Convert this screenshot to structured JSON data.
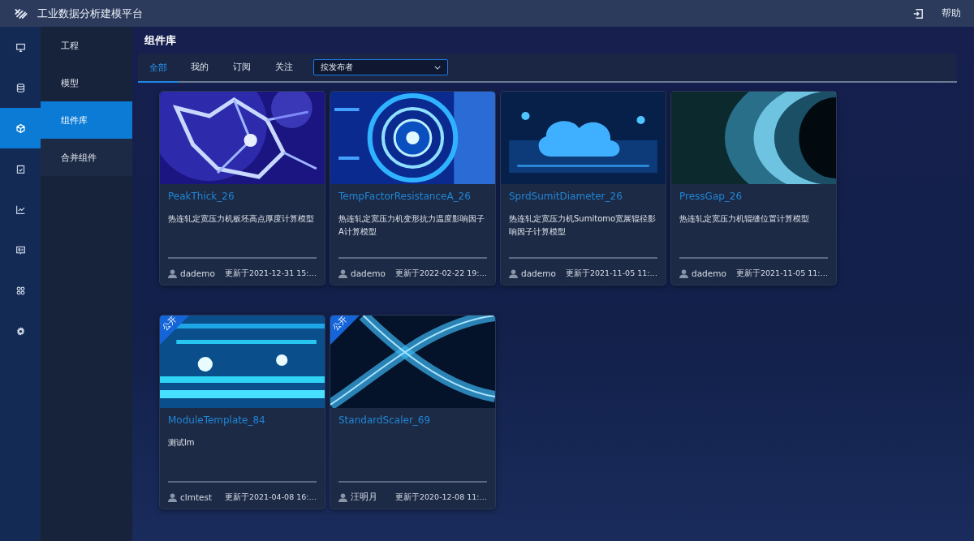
{
  "header": {
    "title": "工业数据分析建模平台",
    "help": "帮助"
  },
  "rail": [
    {
      "selected": false
    },
    {
      "selected": false
    },
    {
      "selected": true
    },
    {
      "selected": false
    },
    {
      "selected": false
    },
    {
      "selected": false
    },
    {
      "selected": false
    },
    {
      "selected": false
    }
  ],
  "submenu": [
    {
      "label": "工程",
      "selected": false
    },
    {
      "label": "模型",
      "selected": false
    },
    {
      "label": "组件库",
      "selected": true
    },
    {
      "label": "合并组件",
      "selected": false
    }
  ],
  "page_title": "组件库",
  "tabs": [
    {
      "label": "全部",
      "selected": true
    },
    {
      "label": "我的",
      "selected": false
    },
    {
      "label": "订阅",
      "selected": false
    },
    {
      "label": "关注",
      "selected": false
    }
  ],
  "filter": {
    "value": "按发布者"
  },
  "cards": [
    {
      "title": "PeakThick_26",
      "description": "热连轧定宽压力机板坯高点厚度计算模型",
      "author": "dademo",
      "updated": "更新于2021-12-31 15:…"
    },
    {
      "title": "TempFactorResistanceA_26",
      "description": "热连轧定宽压力机变形抗力温度影响因子A计算模型",
      "author": "dademo",
      "updated": "更新于2022-02-22 19:…"
    },
    {
      "title": "SprdSumitDiameter_26",
      "description": "热连轧定宽压力机Sumitomo宽展辊径影响因子计算模型",
      "author": "dademo",
      "updated": "更新于2021-11-05 11:…"
    },
    {
      "title": "PressGap_26",
      "description": "热连轧定宽压力机辊缝位置计算模型",
      "author": "dademo",
      "updated": "更新于2021-11-05 11:…"
    },
    {
      "badge": "公开",
      "title": "ModuleTemplate_84",
      "description": "测试lm",
      "author": "clmtest",
      "updated": "更新于2021-04-08 16:…"
    },
    {
      "badge": "公开",
      "title": "StandardScaler_69",
      "author": "汪明月",
      "updated": "更新于2020-12-08 11:…"
    }
  ]
}
